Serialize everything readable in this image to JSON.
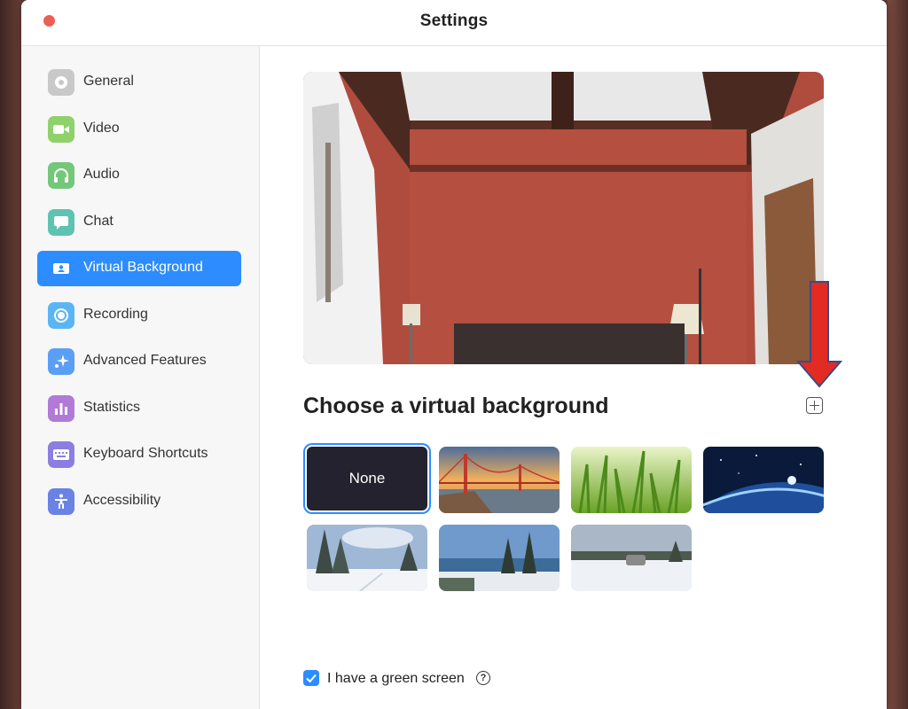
{
  "window": {
    "title": "Settings"
  },
  "sidebar": {
    "items": [
      {
        "label": "General",
        "icon": "gear-icon",
        "color": "#c4c4c4"
      },
      {
        "label": "Video",
        "icon": "video-camera-icon",
        "color": "#8fd16a"
      },
      {
        "label": "Audio",
        "icon": "headphones-icon",
        "color": "#74c77b"
      },
      {
        "label": "Chat",
        "icon": "chat-bubble-icon",
        "color": "#5fc3b1"
      },
      {
        "label": "Virtual Background",
        "icon": "person-card-icon",
        "color": "#2d8cff",
        "active": true
      },
      {
        "label": "Recording",
        "icon": "record-icon",
        "color": "#5bb5f4"
      },
      {
        "label": "Advanced Features",
        "icon": "sparkle-icon",
        "color": "#5b9ef5"
      },
      {
        "label": "Statistics",
        "icon": "bar-chart-icon",
        "color": "#b07ad6"
      },
      {
        "label": "Keyboard Shortcuts",
        "icon": "keyboard-icon",
        "color": "#8c7ee0"
      },
      {
        "label": "Accessibility",
        "icon": "accessibility-icon",
        "color": "#6b82e5"
      }
    ]
  },
  "main": {
    "heading": "Choose a virtual background",
    "add_icon": "plus-square-icon",
    "backgrounds": [
      {
        "label": "None",
        "kind": "none",
        "selected": true
      },
      {
        "label": "",
        "kind": "golden-gate-bridge"
      },
      {
        "label": "",
        "kind": "grass"
      },
      {
        "label": "",
        "kind": "earth-from-space"
      },
      {
        "label": "",
        "kind": "snowy-forest"
      },
      {
        "label": "",
        "kind": "lake-trees"
      },
      {
        "label": "",
        "kind": "snowy-field"
      }
    ],
    "green_screen": {
      "label": "I have a green screen",
      "checked": true,
      "help_icon": "?"
    }
  },
  "colors": {
    "accent": "#2d8cff",
    "annotation_arrow": "#e32b22"
  }
}
